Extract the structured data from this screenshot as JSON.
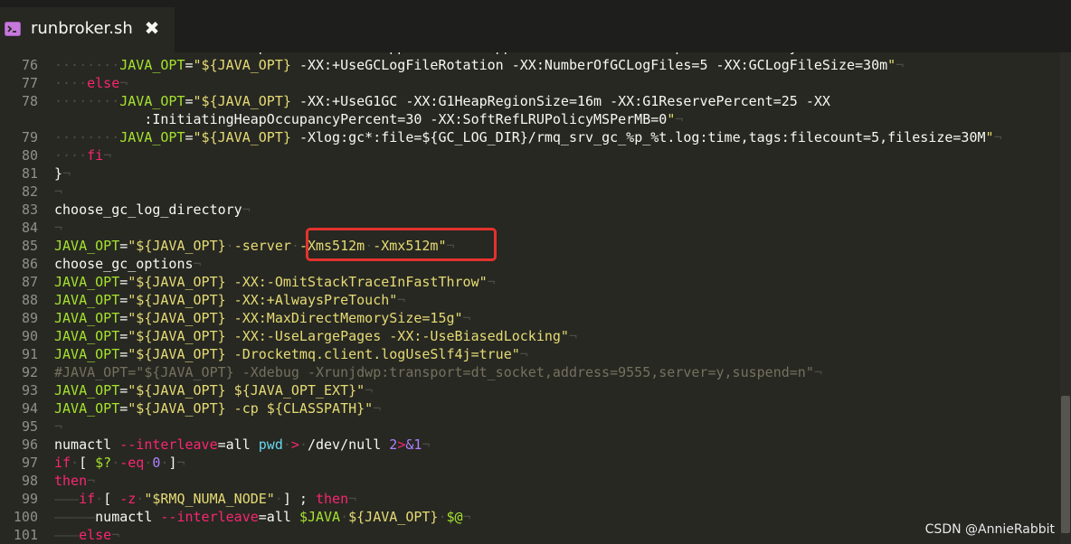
{
  "tab": {
    "title": "runbroker.sh",
    "close_glyph": "✖",
    "icon": "terminal-icon"
  },
  "lines": [
    {
      "n": "",
      "segs": [
        [
          "i",
          "····"
        ],
        [
          "",
          "·-XX:+PrintGCDateStamps -XX:+PrintGCApplicationStoppedTime -XX:+PrintAdaptiveSizePolicy"
        ]
      ]
    },
    {
      "n": "76",
      "segs": [
        [
          "i",
          "········"
        ],
        [
          "v",
          "JAVA_OPT"
        ],
        [
          "",
          "="
        ],
        [
          "s",
          "\"${JAVA_OPT} "
        ],
        [
          "",
          "-XX:+UseGCLogFileRotation -XX:NumberOfGCLogFiles=5 -XX:GCLogFileSize=30m"
        ],
        [
          "s",
          "\""
        ],
        [
          "i",
          "¬"
        ]
      ]
    },
    {
      "n": "77",
      "segs": [
        [
          "i",
          "····"
        ],
        [
          "k",
          "else"
        ],
        [
          "i",
          "¬"
        ]
      ]
    },
    {
      "n": "78",
      "segs": [
        [
          "i",
          "········"
        ],
        [
          "v",
          "JAVA_OPT"
        ],
        [
          "",
          "="
        ],
        [
          "s",
          "\"${JAVA_OPT} "
        ],
        [
          "",
          "-XX:+UseG1GC -XX:G1HeapRegionSize=16m -XX:G1ReservePercent=25 -XX"
        ]
      ]
    },
    {
      "n": "",
      "segs": [
        [
          "",
          "           :InitiatingHeapOccupancyPercent=30 -XX:SoftRefLRUPolicyMSPerMB=0"
        ],
        [
          "s",
          "\""
        ],
        [
          "i",
          "¬"
        ]
      ]
    },
    {
      "n": "79",
      "segs": [
        [
          "i",
          "········"
        ],
        [
          "v",
          "JAVA_OPT"
        ],
        [
          "",
          "="
        ],
        [
          "s",
          "\"${JAVA_OPT} "
        ],
        [
          "",
          "-Xlog:gc*:file=${GC_LOG_DIR}/rmq_srv_gc_%p_%t.log:time,tags:filecount=5,filesize=30M"
        ],
        [
          "s",
          "\""
        ],
        [
          "i",
          "¬"
        ]
      ]
    },
    {
      "n": "80",
      "segs": [
        [
          "i",
          "····"
        ],
        [
          "k",
          "fi"
        ],
        [
          "i",
          "¬"
        ]
      ]
    },
    {
      "n": "81",
      "segs": [
        [
          "",
          "}"
        ],
        [
          "i",
          "¬"
        ]
      ]
    },
    {
      "n": "82",
      "segs": [
        [
          "i",
          "¬"
        ]
      ]
    },
    {
      "n": "83",
      "segs": [
        [
          "",
          "choose_gc_log_directory"
        ],
        [
          "i",
          "¬"
        ]
      ]
    },
    {
      "n": "84",
      "segs": [
        [
          "i",
          "¬"
        ]
      ]
    },
    {
      "n": "85",
      "segs": [
        [
          "v",
          "JAVA_OPT"
        ],
        [
          "",
          "="
        ],
        [
          "s",
          "\"${JAVA_OPT}"
        ],
        [
          "i",
          "·"
        ],
        [
          "s",
          "-server"
        ],
        [
          "i",
          "·"
        ],
        [
          "s",
          "-Xms512m"
        ],
        [
          "i",
          "·"
        ],
        [
          "s",
          "-Xmx512m\""
        ],
        [
          "i",
          "¬"
        ]
      ]
    },
    {
      "n": "86",
      "segs": [
        [
          "",
          "choose_gc_options"
        ],
        [
          "i",
          "¬"
        ]
      ]
    },
    {
      "n": "87",
      "segs": [
        [
          "v",
          "JAVA_OPT"
        ],
        [
          "",
          "="
        ],
        [
          "s",
          "\"${JAVA_OPT} -XX:-OmitStackTraceInFastThrow\""
        ],
        [
          "i",
          "¬"
        ]
      ]
    },
    {
      "n": "88",
      "segs": [
        [
          "v",
          "JAVA_OPT"
        ],
        [
          "",
          "="
        ],
        [
          "s",
          "\"${JAVA_OPT} -XX:+AlwaysPreTouch\""
        ],
        [
          "i",
          "¬"
        ]
      ]
    },
    {
      "n": "89",
      "segs": [
        [
          "v",
          "JAVA_OPT"
        ],
        [
          "",
          "="
        ],
        [
          "s",
          "\"${JAVA_OPT} -XX:MaxDirectMemorySize=15g\""
        ],
        [
          "i",
          "¬"
        ]
      ]
    },
    {
      "n": "90",
      "segs": [
        [
          "v",
          "JAVA_OPT"
        ],
        [
          "",
          "="
        ],
        [
          "s",
          "\"${JAVA_OPT} -XX:-UseLargePages -XX:-UseBiasedLocking\""
        ],
        [
          "i",
          "¬"
        ]
      ]
    },
    {
      "n": "91",
      "segs": [
        [
          "v",
          "JAVA_OPT"
        ],
        [
          "",
          "="
        ],
        [
          "s",
          "\"${JAVA_OPT} -Drocketmq.client.logUseSlf4j=true\""
        ],
        [
          "i",
          "¬"
        ]
      ]
    },
    {
      "n": "92",
      "segs": [
        [
          "c",
          "#JAVA_OPT=\"${JAVA_OPT} -Xdebug -Xrunjdwp:transport=dt_socket,address=9555,server=y,suspend=n\""
        ],
        [
          "i",
          "¬"
        ]
      ]
    },
    {
      "n": "93",
      "segs": [
        [
          "v",
          "JAVA_OPT"
        ],
        [
          "",
          "="
        ],
        [
          "s",
          "\"${JAVA_OPT} ${JAVA_OPT_EXT}\""
        ],
        [
          "i",
          "¬"
        ]
      ]
    },
    {
      "n": "94",
      "segs": [
        [
          "v",
          "JAVA_OPT"
        ],
        [
          "",
          "="
        ],
        [
          "s",
          "\"${JAVA_OPT} -cp ${CLASSPATH}\""
        ],
        [
          "i",
          "¬"
        ]
      ]
    },
    {
      "n": "95",
      "segs": [
        [
          "i",
          "¬"
        ]
      ]
    },
    {
      "n": "96",
      "segs": [
        [
          "",
          "numactl "
        ],
        [
          "k",
          "--interleave"
        ],
        [
          "",
          "=all "
        ],
        [
          "b",
          "pwd"
        ],
        [
          "",
          ""
        ],
        [
          "i",
          "·"
        ],
        [
          "k",
          ">"
        ],
        [
          "i",
          "·"
        ],
        [
          "",
          "/dev/null "
        ],
        [
          "n",
          "2"
        ],
        [
          "k",
          ">"
        ],
        [
          "n",
          "&1"
        ],
        [
          "i",
          "¬"
        ]
      ]
    },
    {
      "n": "97",
      "segs": [
        [
          "k",
          "if"
        ],
        [
          "i",
          "·"
        ],
        [
          "",
          "[ "
        ],
        [
          "v",
          "$?"
        ],
        [
          "i",
          "·"
        ],
        [
          "k",
          "-eq"
        ],
        [
          "i",
          "·"
        ],
        [
          "n",
          "0"
        ],
        [
          "i",
          "·"
        ],
        [
          "",
          "]"
        ],
        [
          "i",
          "¬"
        ]
      ]
    },
    {
      "n": "98",
      "segs": [
        [
          "k",
          "then"
        ],
        [
          "i",
          "¬"
        ]
      ]
    },
    {
      "n": "99",
      "segs": [
        [
          "i",
          "———"
        ],
        [
          "k",
          "if"
        ],
        [
          "i",
          "·"
        ],
        [
          "",
          "[ "
        ],
        [
          "k",
          "-z"
        ],
        [
          "i",
          "·"
        ],
        [
          "s",
          "\"$RMQ_NUMA_NODE\""
        ],
        [
          "i",
          "·"
        ],
        [
          "",
          "] ; "
        ],
        [
          "k",
          "then"
        ],
        [
          "i",
          "¬"
        ]
      ]
    },
    {
      "n": "100",
      "segs": [
        [
          "i",
          "—————"
        ],
        [
          "",
          "numactl "
        ],
        [
          "k",
          "--interleave"
        ],
        [
          "",
          "=all "
        ],
        [
          "v",
          "$JAVA"
        ],
        [
          "",
          ""
        ],
        [
          "i",
          "·"
        ],
        [
          "s",
          "${JAVA_OPT}"
        ],
        [
          "i",
          "·"
        ],
        [
          "v",
          "$@"
        ],
        [
          "i",
          "¬"
        ]
      ]
    },
    {
      "n": "101",
      "segs": [
        [
          "i",
          "———"
        ],
        [
          "k",
          "else"
        ],
        [
          "i",
          "¬"
        ]
      ]
    }
  ],
  "watermark": "CSDN @AnnieRabbit",
  "colors": {
    "background": "#272822",
    "highlight_border": "#e5322d",
    "string": "#e6db74",
    "keyword": "#f92672",
    "variable": "#a6e22e"
  }
}
